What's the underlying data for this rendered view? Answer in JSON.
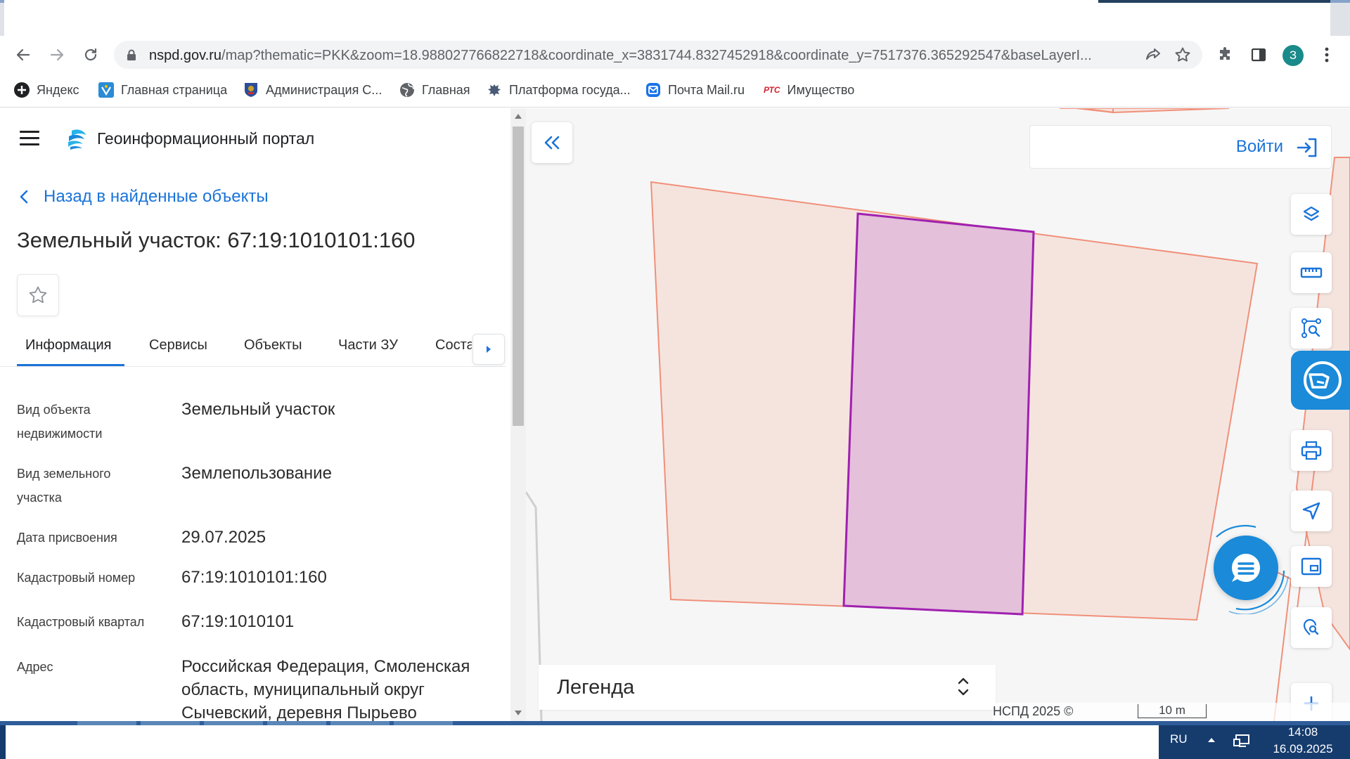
{
  "browser": {
    "url_host": "nspd.gov.ru",
    "url_rest": "/map?thematic=PKK&zoom=18.988027766822718&coordinate_x=3831744.8327452918&coordinate_y=7517376.365292547&baseLayerI...",
    "profile_initial": "З",
    "bookmarks": [
      {
        "label": "Яндекс",
        "icon": "yandex-icon"
      },
      {
        "label": "Главная страница",
        "icon": "gosuslugi-icon"
      },
      {
        "label": "Администрация С...",
        "icon": "coat-of-arms-icon"
      },
      {
        "label": "Главная",
        "icon": "globe-icon"
      },
      {
        "label": "Платформа госуда...",
        "icon": "eagle-icon"
      },
      {
        "label": "Почта Mail.ru",
        "icon": "mail-icon"
      },
      {
        "label": "Имущество",
        "icon": "rts-icon",
        "badge": "РТС"
      }
    ]
  },
  "panel": {
    "portal_title": "Геоинформационный портал",
    "back_label": "Назад в найденные объекты",
    "object_title": "Земельный участок: 67:19:1010101:160",
    "tabs": [
      "Информация",
      "Сервисы",
      "Объекты",
      "Части ЗУ",
      "Состав"
    ],
    "active_tab": "Информация",
    "rows": [
      {
        "label": "Вид объекта недвижимости",
        "value": "Земельный участок"
      },
      {
        "label": "Вид земельного участка",
        "value": "Землепользование"
      },
      {
        "label": "Дата присвоения",
        "value": "29.07.2025"
      },
      {
        "label": "Кадастровый номер",
        "value": "67:19:1010101:160"
      },
      {
        "label": "Кадастровый квартал",
        "value": "67:19:1010101"
      },
      {
        "label": "Адрес",
        "value": "Российская Федерация, Смоленская область, муниципальный округ Сычевский, деревня Пырьево"
      }
    ]
  },
  "map": {
    "login_label": "Войти",
    "legend_label": "Легенда",
    "attribution": "НСПД 2025 ©",
    "scale_label": "10 m",
    "colors": {
      "parcel_fill": "#f5e4de",
      "parcel_stroke": "#f0907a",
      "selected_fill": "#e4c0da",
      "selected_stroke": "#a020b0",
      "accent": "#1a73d9"
    }
  },
  "taskbar": {
    "lang": "RU",
    "time": "14:08",
    "date": "16.09.2025"
  }
}
